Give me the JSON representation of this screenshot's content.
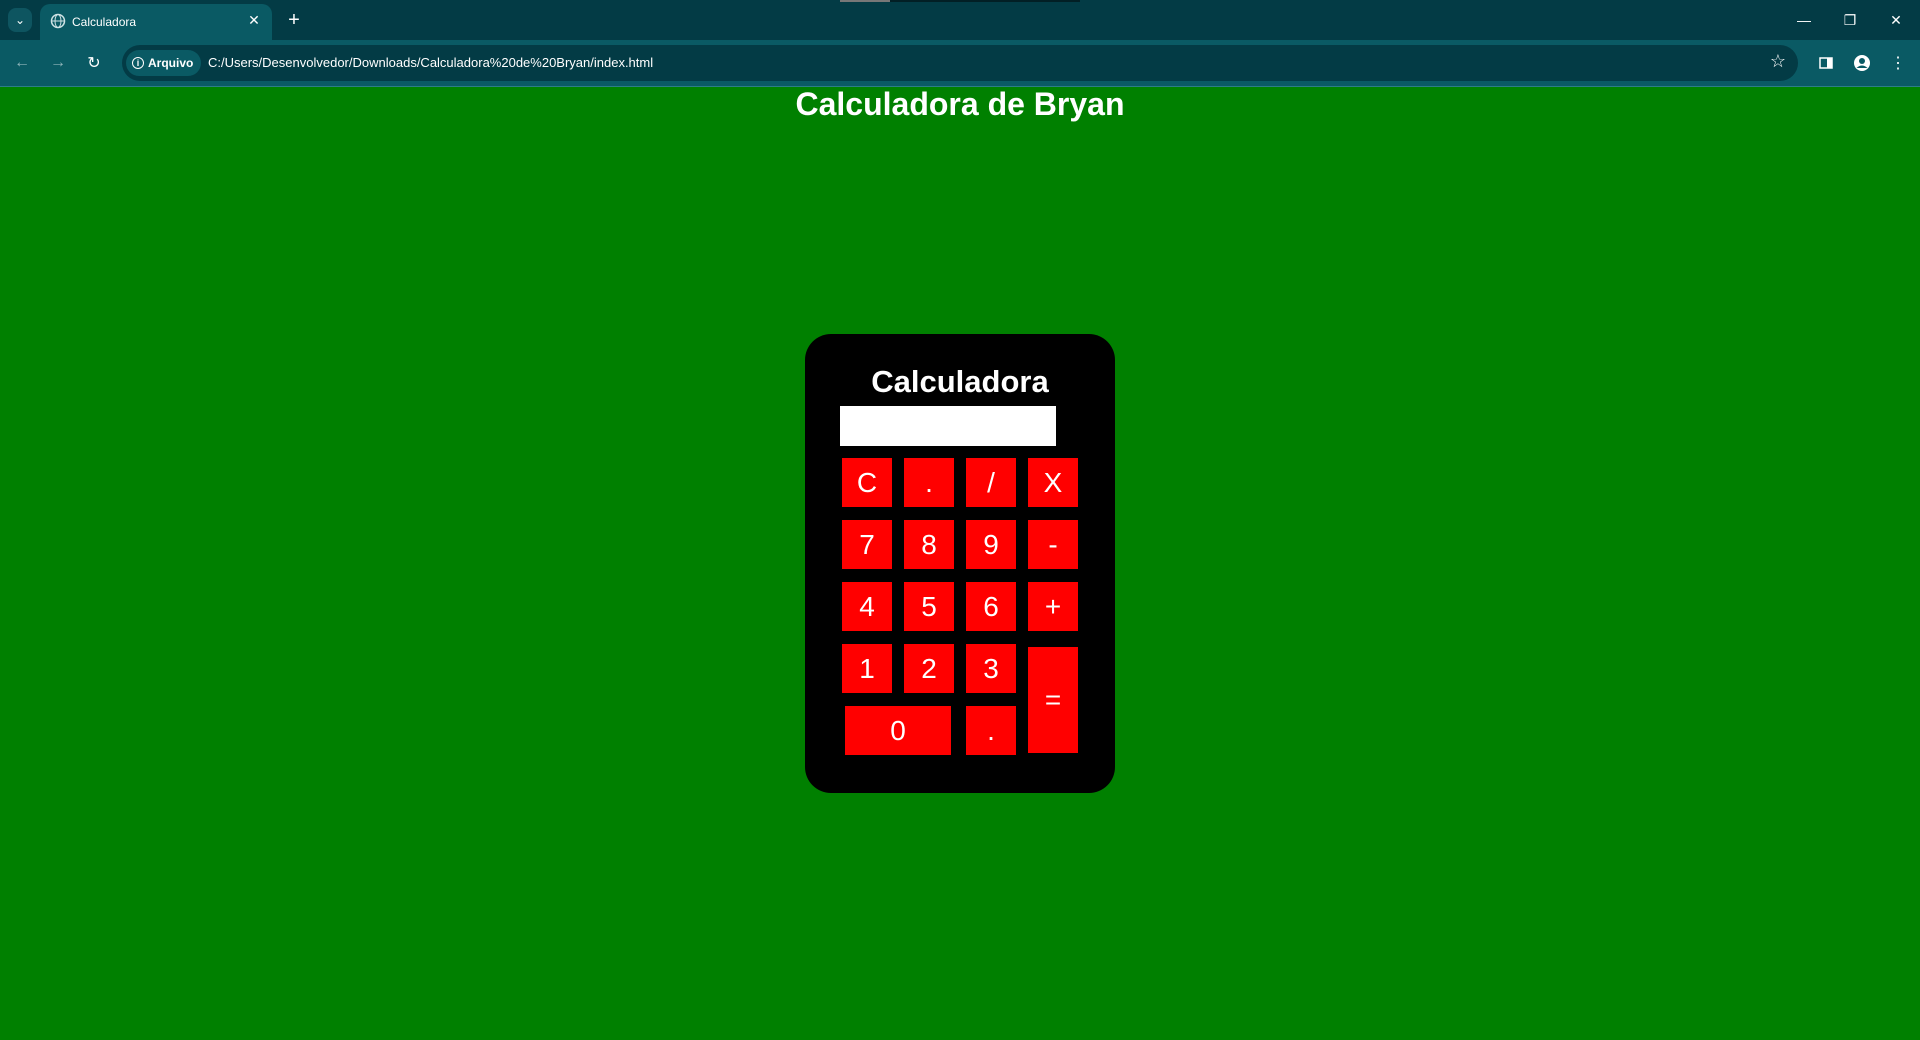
{
  "browser": {
    "tab_title": "Calculadora",
    "tab_close": "✕",
    "new_tab": "+",
    "security_label": "Arquivo",
    "url": "C:/Users/Desenvolvedor/Downloads/Calculadora%20de%20Bryan/index.html",
    "minimize": "—",
    "restore": "❐",
    "close": "✕"
  },
  "page": {
    "heading": "Calculadora de Bryan",
    "background_color": "#008000"
  },
  "calculator": {
    "title": "Calculadora",
    "display_value": "",
    "key_color": "#ff0000",
    "keys": {
      "clear": "C",
      "dot_top": ".",
      "divide": "/",
      "multiply": "X",
      "seven": "7",
      "eight": "8",
      "nine": "9",
      "minus": "-",
      "four": "4",
      "five": "5",
      "six": "6",
      "plus": "+",
      "one": "1",
      "two": "2",
      "three": "3",
      "equals": "=",
      "zero": "0",
      "dot_bottom": "."
    }
  }
}
